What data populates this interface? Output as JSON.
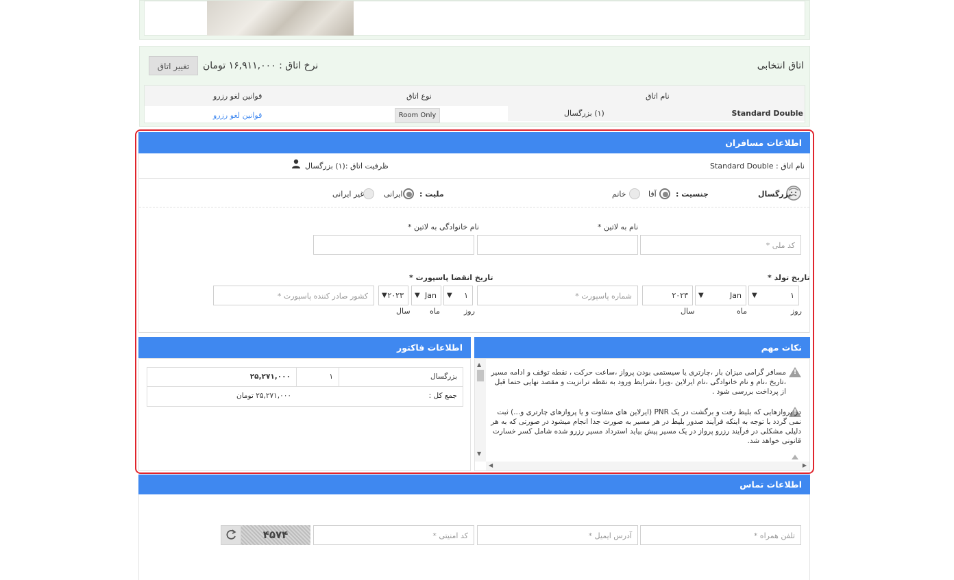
{
  "room_section": {
    "title": "اتاق انتخابی",
    "rate": "نرخ اتاق : ۱۶,۹۱۱,۰۰۰ تومان",
    "change_button": "تغییر اتاق",
    "columns": [
      "نام اتاق",
      "نوع اتاق",
      "قوانین لغو رزرو"
    ],
    "row": {
      "name": "Standard Double",
      "occupancy": "(۱) بزرگسال",
      "type": "Room Only",
      "cancel_link": "قوانین لغو رزرو"
    }
  },
  "passengers": {
    "title": "اطلاعات مسافران",
    "room_name": "نام اتاق : Standard Double",
    "capacity": "ظرفیت اتاق :(۱) بزرگسال",
    "adult_label": "بزرگسال",
    "gender_label": "جنسیت :",
    "gender_male": "آقا",
    "gender_female": "خانم",
    "nationality_label": "ملیت :",
    "nat_iranian": "ایرانی",
    "nat_foreign": "غیر ایرانی",
    "national_code_placeholder": "کد ملی *",
    "first_name_label": "نام به لاتین *",
    "last_name_label": "نام خانوادگی به لاتین *",
    "birth_label": "تاریخ تولد *",
    "passport_exp_label": "تاریخ انقضا پاسپورت *",
    "birth": {
      "day": "۱",
      "month": "Jan",
      "year": "۲۰۲۳"
    },
    "exp": {
      "day": "۱",
      "month": "Jan",
      "year": "۲۰۲۳"
    },
    "day_label": "روز",
    "month_label": "ماه",
    "year_label": "سال",
    "passport_no_placeholder": "شماره پاسپورت *",
    "passport_country_placeholder": "کشور صادر کننده پاسپورت *"
  },
  "notes": {
    "title": "نکات مهم",
    "items": [
      "مسافر گرامی میزان بار ،چارتری یا سیستمی بودن پرواز ،ساعت حرکت ، نقطه توقف و ادامه مسیر ،تاریخ ،نام و نام خانوادگی ،نام ایرلاین ،ویزا ،شرایط ورود به نقطه ترانزیت و مقصد نهایی حتما قبل از پرداخت بررسی شود .",
      "در پروازهایی که بلیط رفت و برگشت در یک PNR (ایرلاین های متفاوت و یا پروازهای چارتری و...) ثبت نمی گردد با توجه به اینکه فرآیند صدور بلیط در هر مسیر به صورت جدا انجام میشود در صورتی که به هر دلیلی مشکلی در فرآیند رزرو پرواز در یک مسیر پیش بیاید استرداد مسیر رزرو شده شامل کسر خسارت قانونی خواهد شد."
    ]
  },
  "invoice": {
    "title": "اطلاعات فاکتور",
    "row_label": "بزرگسال",
    "row_count": "۱",
    "row_amount": "۲۵,۲۷۱,۰۰۰",
    "total_label": "جمع کل :",
    "total_value": "۲۵,۲۷۱,۰۰۰ تومان"
  },
  "contact": {
    "title": "اطلاعات تماس",
    "phone_placeholder": "تلفن همراه *",
    "email_placeholder": "آدرس ایمیل *",
    "captcha_placeholder": "کد امنیتی *",
    "captcha_text": "۴۵۷۴"
  },
  "colors": {
    "accent": "#3f88f0",
    "highlight": "#e0242c",
    "panel": "#eef7ee",
    "link": "#3f88f0"
  }
}
